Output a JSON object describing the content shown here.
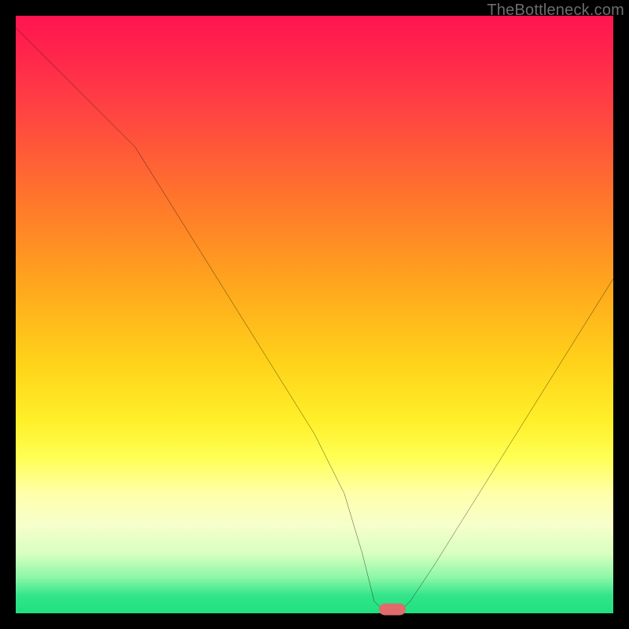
{
  "watermark": "TheBottleneck.com",
  "marker": {
    "x_pct": 63,
    "y_pct": 99.4,
    "color": "#e06b6b"
  },
  "chart_data": {
    "type": "line",
    "title": "",
    "xlabel": "",
    "ylabel": "",
    "xlim": [
      0,
      100
    ],
    "ylim": [
      0,
      100
    ],
    "grid": false,
    "legend": false,
    "series": [
      {
        "name": "bottleneck-curve",
        "x": [
          0,
          5,
          10,
          15,
          20,
          25,
          30,
          35,
          40,
          45,
          50,
          55,
          58,
          60,
          62,
          64,
          66,
          70,
          75,
          80,
          85,
          90,
          95,
          100
        ],
        "y": [
          98,
          93,
          88,
          83,
          78,
          70,
          62,
          54,
          46,
          38,
          30,
          20,
          10,
          2,
          0,
          0,
          2,
          8,
          16,
          24,
          32,
          40,
          48,
          56
        ]
      }
    ],
    "annotations": []
  }
}
